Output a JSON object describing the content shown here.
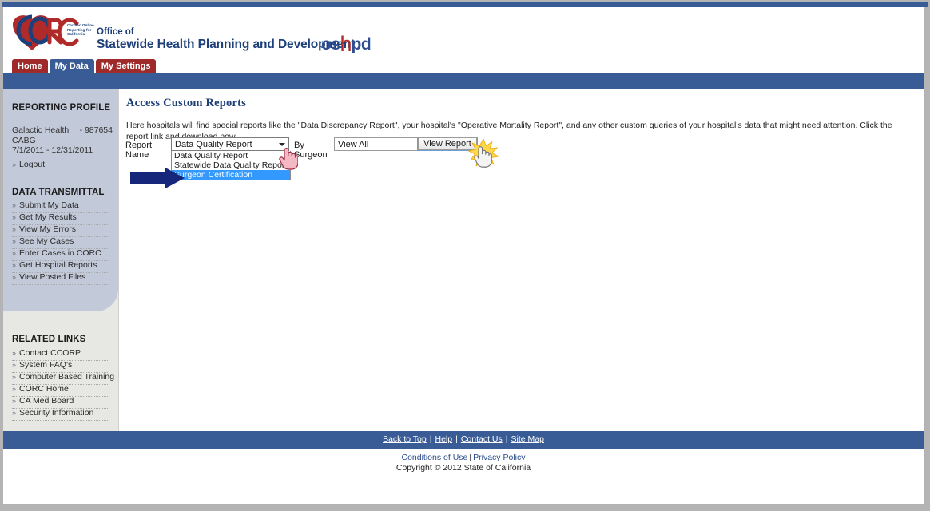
{
  "brand": {
    "logo_tagline": "Cardiac Online Reporting for California",
    "office_of": "Office of",
    "agency_name": "Statewide Health Planning and Development",
    "oshpd_prefix": "os",
    "oshpd_mark": "h",
    "oshpd_suffix": "pd"
  },
  "tabs": [
    {
      "label": "Home",
      "active": false
    },
    {
      "label": "My Data",
      "active": true
    },
    {
      "label": "My Settings",
      "active": false
    }
  ],
  "sidebar": {
    "reporting_profile_heading": "REPORTING PROFILE",
    "profile": {
      "hospital": "Galactic Health",
      "dash": "-",
      "id": "987654",
      "procedure": "CABG",
      "period": "7/1/2011  -  12/31/2011"
    },
    "logout_label": "Logout",
    "data_transmittal_heading": "DATA TRANSMITTAL",
    "data_transmittal_items": [
      "Submit My Data",
      "Get My Results",
      "View My Errors",
      "See My Cases",
      "Enter Cases in CORC",
      "Get Hospital Reports",
      "View Posted Files"
    ],
    "related_links_heading": "RELATED LINKS",
    "related_links_items": [
      "Contact CCORP",
      "System FAQ's",
      "Computer Based Training",
      "CORC Home",
      "CA Med Board",
      "Security Information"
    ]
  },
  "main": {
    "page_title": "Access Custom Reports",
    "intro": "Here hospitals will find special reports like the \"Data Discrepancy Report\", your hospital's \"Operative Mortality Report\", and any other custom queries of your hospital's data that might need attention. Click the report link and download now.",
    "report_name_label": "Report Name",
    "report_name_value": "Data Quality Report",
    "report_name_options": [
      {
        "label": "Data Quality Report",
        "selected": false
      },
      {
        "label": "Statewide Data Quality Report",
        "selected": false
      },
      {
        "label": "Surgeon Certification",
        "selected": true
      }
    ],
    "by_surgeon_label": "By Surgeon",
    "by_surgeon_value": "View All",
    "view_report_button": "View Report"
  },
  "footer": {
    "links": [
      "Back to Top",
      "Help",
      "Contact Us",
      "Site Map"
    ],
    "separator": "|",
    "conditions_of_use": "Conditions of Use",
    "privacy_policy": "Privacy Policy",
    "copyright": "Copyright © 2012 State of California"
  },
  "colors": {
    "brand_blue": "#3a5c96",
    "tab_red": "#9e2a2a",
    "heading_blue": "#1f3f77",
    "highlight_blue": "#3399ff",
    "arrow_navy": "#16267a",
    "sidebar_panel": "#c2c9d8",
    "sidebar_bg": "#e7e7e3",
    "oshpd_red": "#b02a2a"
  }
}
